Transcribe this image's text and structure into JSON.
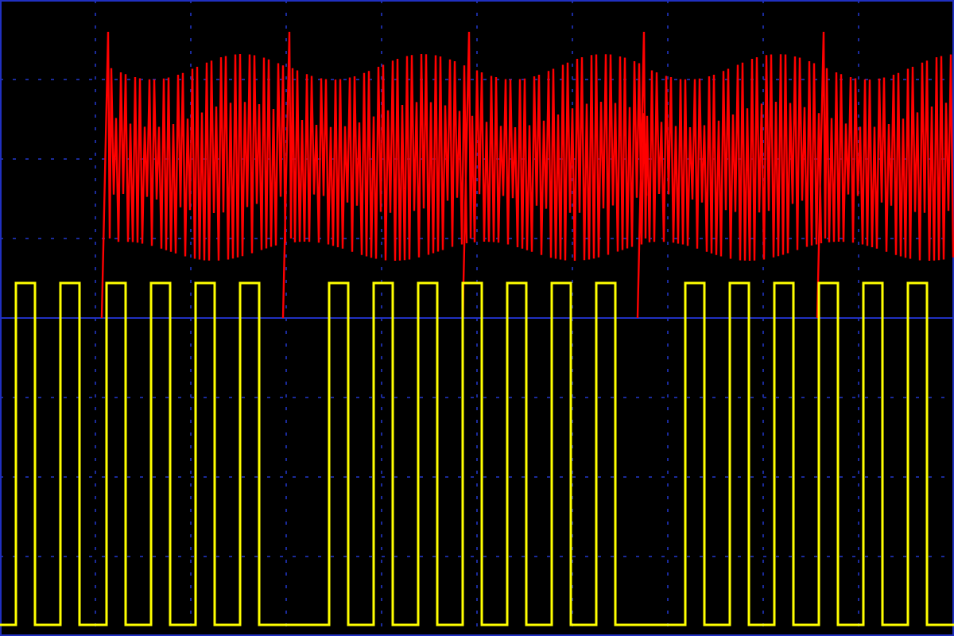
{
  "screen": {
    "channels": [
      {
        "kind": "burst",
        "color": "#ff0000"
      },
      {
        "kind": "square",
        "color": "#ffff00"
      }
    ]
  }
}
